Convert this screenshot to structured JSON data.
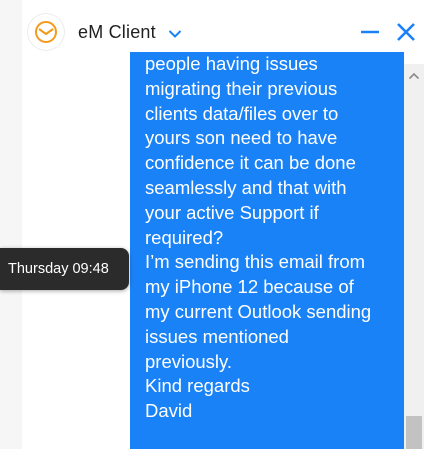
{
  "header": {
    "app_title": "eM Client",
    "icons": {
      "logo": "em-client-logo-icon",
      "dropdown": "chevron-down-icon",
      "minimize": "minimize-icon",
      "close": "close-icon"
    }
  },
  "colors": {
    "accent": "#1a82f7",
    "logo_orange": "#f49a1b",
    "tooltip_bg": "#2b2b2b"
  },
  "message": {
    "lines": [
      "people having issues",
      "migrating their previous",
      "clients data/files over to",
      "yours son need to have",
      "confidence it can be done",
      "seamlessly and that with",
      "your active Support if",
      "required?",
      "I’m sending this email from",
      "my iPhone 12 because of",
      "my current Outlook sending",
      "issues mentioned",
      "previously.",
      "Kind regards",
      "David"
    ]
  },
  "tooltip": {
    "text": "Thursday 09:48"
  },
  "scrollbar": {
    "up_icon": "arrow-up-icon"
  }
}
